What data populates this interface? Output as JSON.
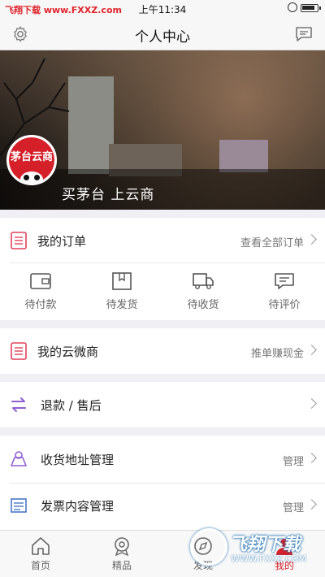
{
  "statusbar": {
    "watermark": "飞翔下载 www.FXXZ.com",
    "time": "上午11:34",
    "battery_level": 0.9
  },
  "header": {
    "title": "个人中心",
    "settings_icon": "gear-icon",
    "message_icon": "chat-bubble-icon"
  },
  "banner": {
    "slogan": "买茅台 上云商",
    "avatar_text": "茅台云商"
  },
  "my_orders": {
    "label": "我的订单",
    "link": "查看全部订单",
    "icon": "order-list-icon"
  },
  "order_tabs": [
    {
      "label": "待付款",
      "icon": "wallet-icon"
    },
    {
      "label": "待发货",
      "icon": "package-icon"
    },
    {
      "label": "待收货",
      "icon": "truck-icon"
    },
    {
      "label": "待评价",
      "icon": "comment-icon"
    }
  ],
  "cloud_shop": {
    "label": "我的云微商",
    "link": "推单赚现金",
    "icon": "order-list-icon"
  },
  "refund": {
    "label": "退款 / 售后",
    "icon": "exchange-arrows-icon"
  },
  "address": {
    "label": "收货地址管理",
    "link": "管理",
    "icon": "map-pin-icon"
  },
  "invoice": {
    "label": "发票内容管理",
    "link": "管理",
    "icon": "invoice-icon"
  },
  "tabbar": [
    {
      "label": "首页",
      "icon": "home-icon"
    },
    {
      "label": "精品",
      "icon": "medal-icon"
    },
    {
      "label": "发现",
      "icon": "compass-icon"
    },
    {
      "label": "我的",
      "icon": "user-icon"
    }
  ],
  "watermark_logo": {
    "text": "飞翔下载",
    "url": "WWW.FXXZ.COM"
  },
  "colors": {
    "accent": "#d5202a",
    "icon_red": "#e2415a",
    "icon_purple": "#8e5fd1",
    "background": "#efeff4"
  }
}
